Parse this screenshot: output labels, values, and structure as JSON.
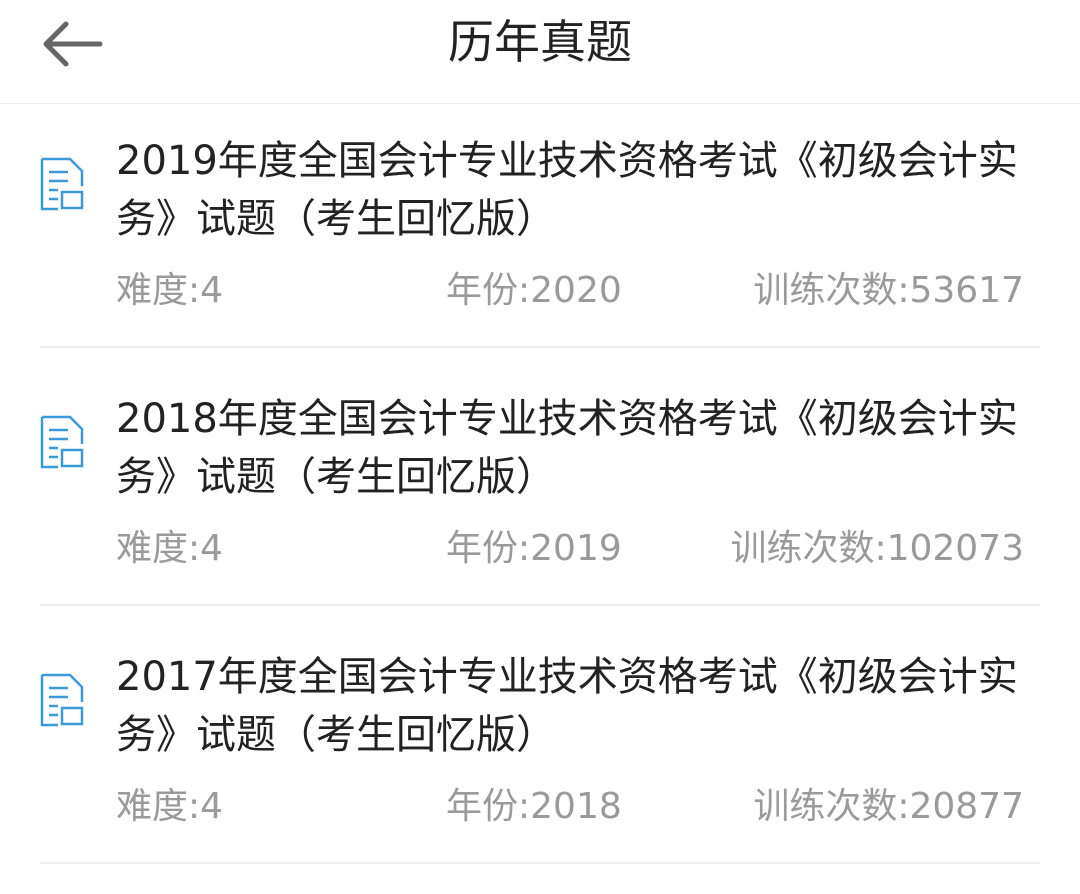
{
  "header": {
    "title": "历年真题",
    "back_icon": "back-arrow-icon"
  },
  "colors": {
    "accent": "#3a9ad9",
    "text": "#222222",
    "meta": "#9a9a9a",
    "divider": "#f0f0f0"
  },
  "items": [
    {
      "title": "2019年度全国会计专业技术资格考试《初级会计实务》试题（考生回忆版）",
      "difficulty": "难度:4",
      "year": "年份:2020",
      "count": "训练次数:53617",
      "icon": "document-icon"
    },
    {
      "title": "2018年度全国会计专业技术资格考试《初级会计实务》试题（考生回忆版）",
      "difficulty": "难度:4",
      "year": "年份:2019",
      "count": "训练次数:102073",
      "icon": "document-icon"
    },
    {
      "title": "2017年度全国会计专业技术资格考试《初级会计实务》试题（考生回忆版）",
      "difficulty": "难度:4",
      "year": "年份:2018",
      "count": "训练次数:20877",
      "icon": "document-icon"
    }
  ]
}
